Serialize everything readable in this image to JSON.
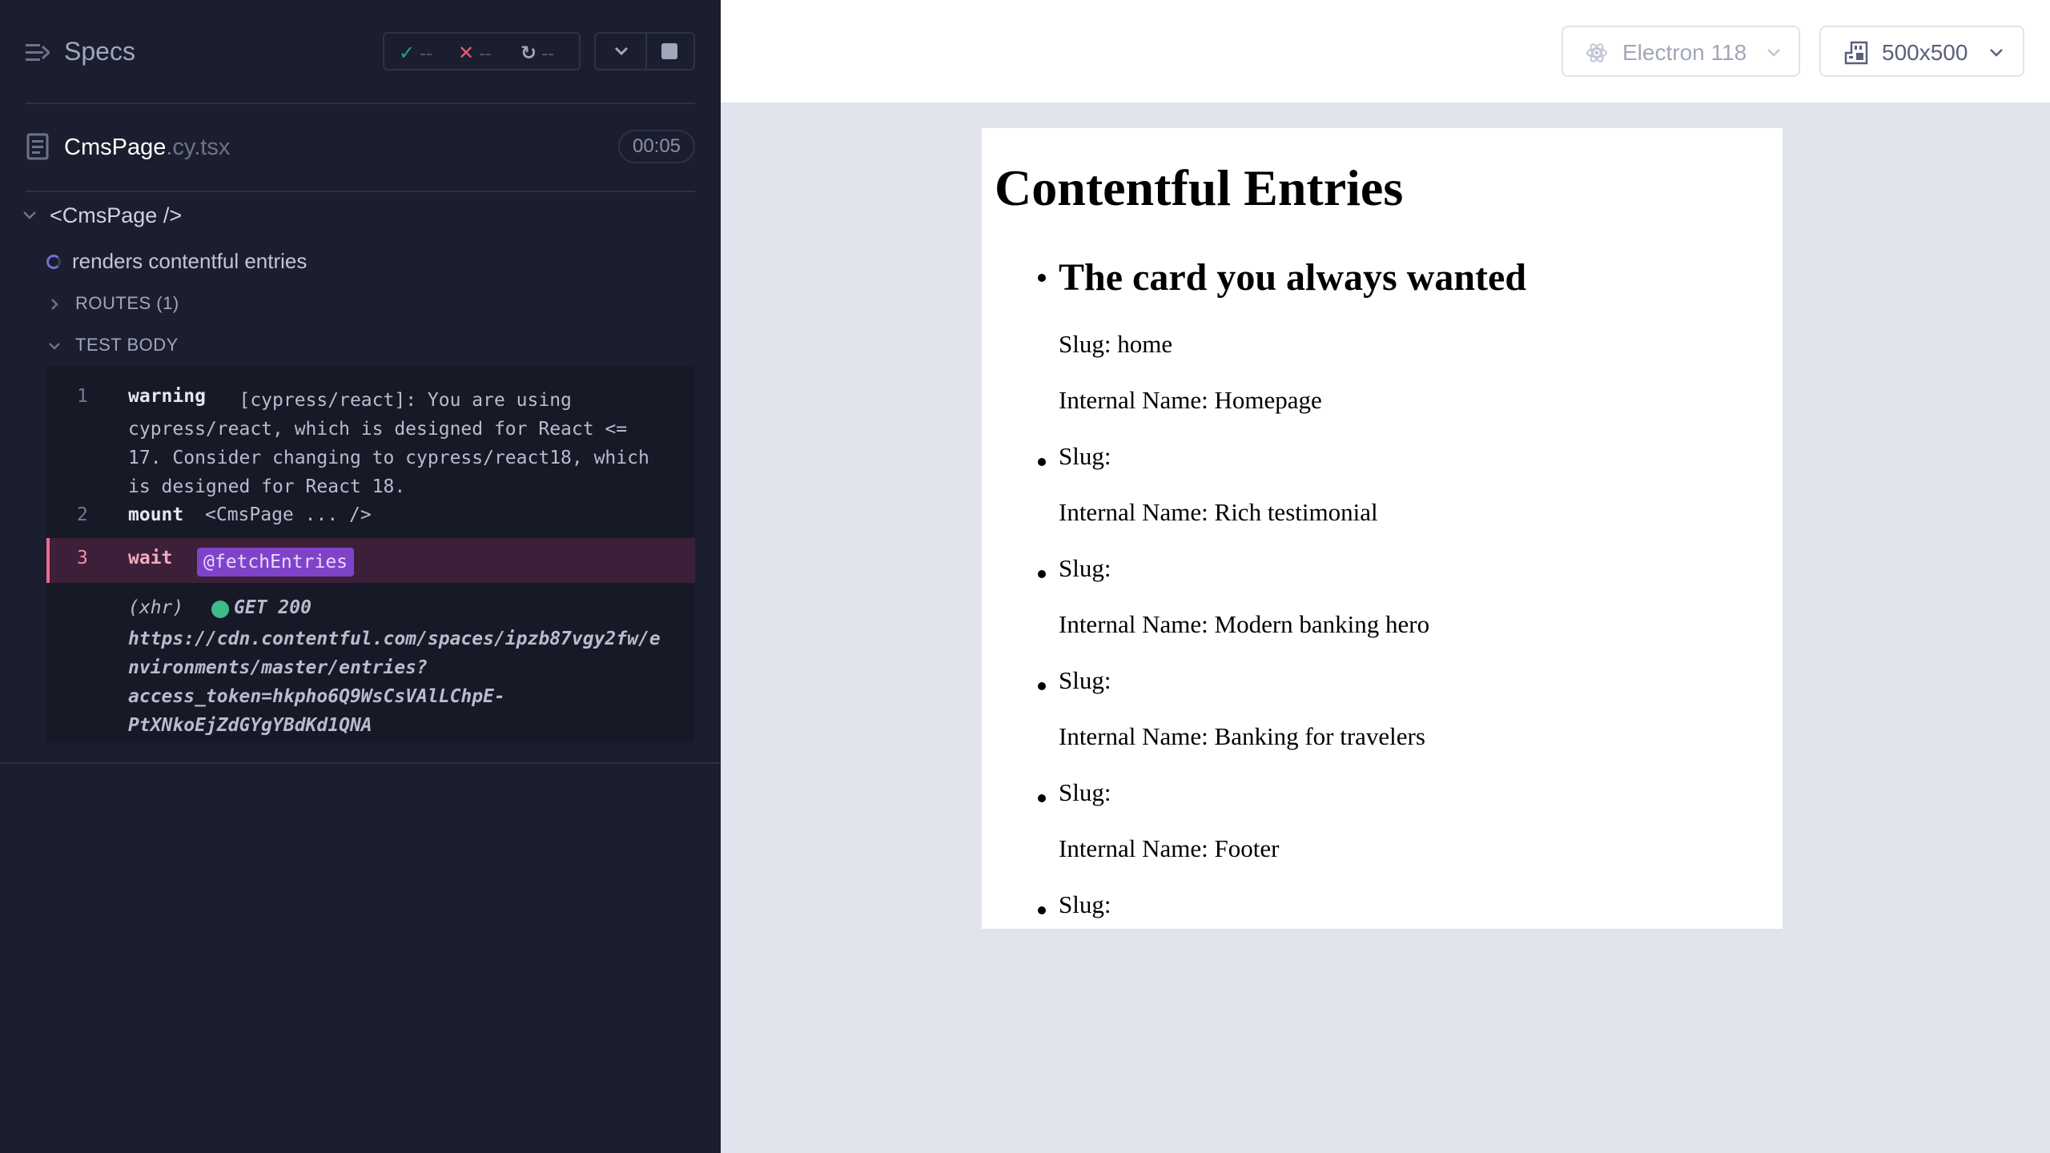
{
  "reporter": {
    "specs_title": "Specs",
    "stats": {
      "passed": "--",
      "failed": "--",
      "pending": "--"
    },
    "spec_file": {
      "name": "CmsPage",
      "ext": ".cy.tsx",
      "duration": "00:05"
    },
    "suite": {
      "title": "<CmsPage />"
    },
    "test": {
      "title": "renders contentful entries"
    },
    "groups": {
      "routes": "ROUTES (1)",
      "test_body": "TEST BODY"
    },
    "commands": [
      {
        "num": "1",
        "name": "warning",
        "message": "          [cypress/react]: You are using\ncypress/react, which is designed for React <=\n17. Consider changing to cypress/react18, which\nis designed for React 18."
      },
      {
        "num": "2",
        "name": "mount",
        "message": "<CmsPage ... />"
      },
      {
        "num": "3",
        "name": "wait",
        "alias": "@fetchEntries"
      }
    ],
    "xhr": {
      "type": "(xhr)",
      "status": "GET 200",
      "url": "https://cdn.contentful.com/spaces/ipzb87vgy2fw/e\nnvironments/master/entries?\naccess_token=hkpho6Q9WsCsVAlLChpE-\nPtXNkoEjZdGYgYBdKd1QNA"
    }
  },
  "preview": {
    "browser": "Electron 118",
    "viewport": "500x500",
    "app": {
      "heading": "Contentful Entries",
      "entries": [
        {
          "title": "The card you always wanted",
          "slug": "Slug: home",
          "internal_name": "Internal Name: Homepage"
        },
        {
          "slug": "Slug:",
          "internal_name": "Internal Name: Rich testimonial"
        },
        {
          "slug": "Slug:",
          "internal_name": "Internal Name: Modern banking hero"
        },
        {
          "slug": "Slug:",
          "internal_name": "Internal Name: Banking for travelers"
        },
        {
          "slug": "Slug:",
          "internal_name": "Internal Name: Footer"
        },
        {
          "slug": "Slug:"
        }
      ]
    }
  },
  "colors": {
    "reporter_bg": "#1b1e2e",
    "pass": "#1fa971",
    "fail": "#f05a72",
    "active_command_bg": "#3c1f38",
    "alias_badge": "#7f43c9",
    "xhr_ok_dot": "#3dbc8a",
    "preview_bg": "#e1e3ed"
  },
  "icons": [
    "specs-toggle-icon",
    "check-icon",
    "x-icon",
    "spinner-icon",
    "chevron-down-icon",
    "stop-icon",
    "document-icon",
    "chevron-right-icon",
    "electron-icon",
    "ruler-icon"
  ]
}
